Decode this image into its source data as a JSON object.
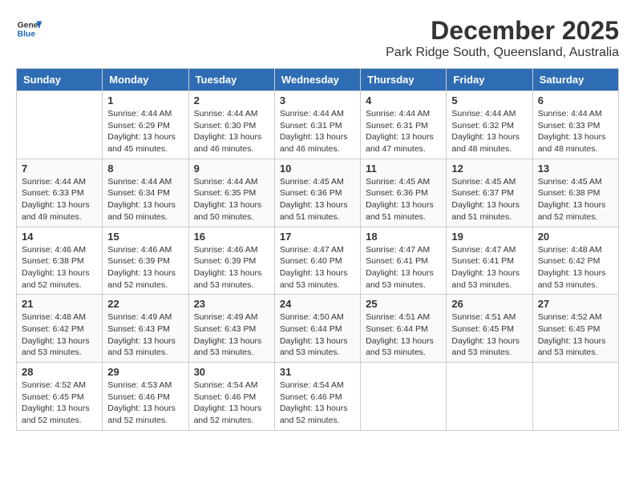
{
  "logo": {
    "general": "General",
    "blue": "Blue"
  },
  "header": {
    "month": "December 2025",
    "location": "Park Ridge South, Queensland, Australia"
  },
  "days_of_week": [
    "Sunday",
    "Monday",
    "Tuesday",
    "Wednesday",
    "Thursday",
    "Friday",
    "Saturday"
  ],
  "weeks": [
    [
      {
        "day": "",
        "sunrise": "",
        "sunset": "",
        "daylight": ""
      },
      {
        "day": "1",
        "sunrise": "Sunrise: 4:44 AM",
        "sunset": "Sunset: 6:29 PM",
        "daylight": "Daylight: 13 hours and 45 minutes."
      },
      {
        "day": "2",
        "sunrise": "Sunrise: 4:44 AM",
        "sunset": "Sunset: 6:30 PM",
        "daylight": "Daylight: 13 hours and 46 minutes."
      },
      {
        "day": "3",
        "sunrise": "Sunrise: 4:44 AM",
        "sunset": "Sunset: 6:31 PM",
        "daylight": "Daylight: 13 hours and 46 minutes."
      },
      {
        "day": "4",
        "sunrise": "Sunrise: 4:44 AM",
        "sunset": "Sunset: 6:31 PM",
        "daylight": "Daylight: 13 hours and 47 minutes."
      },
      {
        "day": "5",
        "sunrise": "Sunrise: 4:44 AM",
        "sunset": "Sunset: 6:32 PM",
        "daylight": "Daylight: 13 hours and 48 minutes."
      },
      {
        "day": "6",
        "sunrise": "Sunrise: 4:44 AM",
        "sunset": "Sunset: 6:33 PM",
        "daylight": "Daylight: 13 hours and 48 minutes."
      }
    ],
    [
      {
        "day": "7",
        "sunrise": "Sunrise: 4:44 AM",
        "sunset": "Sunset: 6:33 PM",
        "daylight": "Daylight: 13 hours and 49 minutes."
      },
      {
        "day": "8",
        "sunrise": "Sunrise: 4:44 AM",
        "sunset": "Sunset: 6:34 PM",
        "daylight": "Daylight: 13 hours and 50 minutes."
      },
      {
        "day": "9",
        "sunrise": "Sunrise: 4:44 AM",
        "sunset": "Sunset: 6:35 PM",
        "daylight": "Daylight: 13 hours and 50 minutes."
      },
      {
        "day": "10",
        "sunrise": "Sunrise: 4:45 AM",
        "sunset": "Sunset: 6:36 PM",
        "daylight": "Daylight: 13 hours and 51 minutes."
      },
      {
        "day": "11",
        "sunrise": "Sunrise: 4:45 AM",
        "sunset": "Sunset: 6:36 PM",
        "daylight": "Daylight: 13 hours and 51 minutes."
      },
      {
        "day": "12",
        "sunrise": "Sunrise: 4:45 AM",
        "sunset": "Sunset: 6:37 PM",
        "daylight": "Daylight: 13 hours and 51 minutes."
      },
      {
        "day": "13",
        "sunrise": "Sunrise: 4:45 AM",
        "sunset": "Sunset: 6:38 PM",
        "daylight": "Daylight: 13 hours and 52 minutes."
      }
    ],
    [
      {
        "day": "14",
        "sunrise": "Sunrise: 4:46 AM",
        "sunset": "Sunset: 6:38 PM",
        "daylight": "Daylight: 13 hours and 52 minutes."
      },
      {
        "day": "15",
        "sunrise": "Sunrise: 4:46 AM",
        "sunset": "Sunset: 6:39 PM",
        "daylight": "Daylight: 13 hours and 52 minutes."
      },
      {
        "day": "16",
        "sunrise": "Sunrise: 4:46 AM",
        "sunset": "Sunset: 6:39 PM",
        "daylight": "Daylight: 13 hours and 53 minutes."
      },
      {
        "day": "17",
        "sunrise": "Sunrise: 4:47 AM",
        "sunset": "Sunset: 6:40 PM",
        "daylight": "Daylight: 13 hours and 53 minutes."
      },
      {
        "day": "18",
        "sunrise": "Sunrise: 4:47 AM",
        "sunset": "Sunset: 6:41 PM",
        "daylight": "Daylight: 13 hours and 53 minutes."
      },
      {
        "day": "19",
        "sunrise": "Sunrise: 4:47 AM",
        "sunset": "Sunset: 6:41 PM",
        "daylight": "Daylight: 13 hours and 53 minutes."
      },
      {
        "day": "20",
        "sunrise": "Sunrise: 4:48 AM",
        "sunset": "Sunset: 6:42 PM",
        "daylight": "Daylight: 13 hours and 53 minutes."
      }
    ],
    [
      {
        "day": "21",
        "sunrise": "Sunrise: 4:48 AM",
        "sunset": "Sunset: 6:42 PM",
        "daylight": "Daylight: 13 hours and 53 minutes."
      },
      {
        "day": "22",
        "sunrise": "Sunrise: 4:49 AM",
        "sunset": "Sunset: 6:43 PM",
        "daylight": "Daylight: 13 hours and 53 minutes."
      },
      {
        "day": "23",
        "sunrise": "Sunrise: 4:49 AM",
        "sunset": "Sunset: 6:43 PM",
        "daylight": "Daylight: 13 hours and 53 minutes."
      },
      {
        "day": "24",
        "sunrise": "Sunrise: 4:50 AM",
        "sunset": "Sunset: 6:44 PM",
        "daylight": "Daylight: 13 hours and 53 minutes."
      },
      {
        "day": "25",
        "sunrise": "Sunrise: 4:51 AM",
        "sunset": "Sunset: 6:44 PM",
        "daylight": "Daylight: 13 hours and 53 minutes."
      },
      {
        "day": "26",
        "sunrise": "Sunrise: 4:51 AM",
        "sunset": "Sunset: 6:45 PM",
        "daylight": "Daylight: 13 hours and 53 minutes."
      },
      {
        "day": "27",
        "sunrise": "Sunrise: 4:52 AM",
        "sunset": "Sunset: 6:45 PM",
        "daylight": "Daylight: 13 hours and 53 minutes."
      }
    ],
    [
      {
        "day": "28",
        "sunrise": "Sunrise: 4:52 AM",
        "sunset": "Sunset: 6:45 PM",
        "daylight": "Daylight: 13 hours and 52 minutes."
      },
      {
        "day": "29",
        "sunrise": "Sunrise: 4:53 AM",
        "sunset": "Sunset: 6:46 PM",
        "daylight": "Daylight: 13 hours and 52 minutes."
      },
      {
        "day": "30",
        "sunrise": "Sunrise: 4:54 AM",
        "sunset": "Sunset: 6:46 PM",
        "daylight": "Daylight: 13 hours and 52 minutes."
      },
      {
        "day": "31",
        "sunrise": "Sunrise: 4:54 AM",
        "sunset": "Sunset: 6:46 PM",
        "daylight": "Daylight: 13 hours and 52 minutes."
      },
      {
        "day": "",
        "sunrise": "",
        "sunset": "",
        "daylight": ""
      },
      {
        "day": "",
        "sunrise": "",
        "sunset": "",
        "daylight": ""
      },
      {
        "day": "",
        "sunrise": "",
        "sunset": "",
        "daylight": ""
      }
    ]
  ]
}
